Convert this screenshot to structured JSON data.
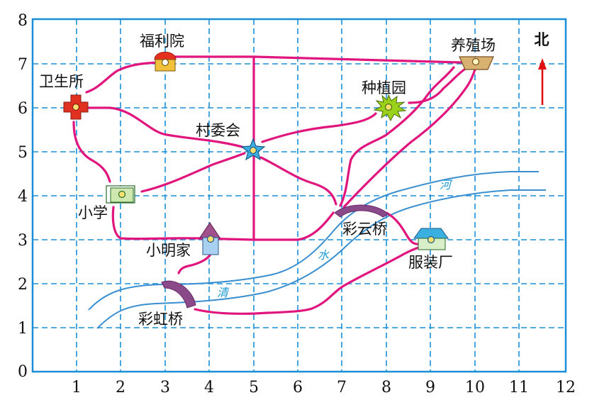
{
  "axes": {
    "x_ticks": [
      "1",
      "2",
      "3",
      "4",
      "5",
      "6",
      "7",
      "8",
      "9",
      "10",
      "11",
      "12"
    ],
    "y_ticks": [
      "0",
      "1",
      "2",
      "3",
      "4",
      "5",
      "6",
      "7",
      "8"
    ]
  },
  "places": {
    "fuliyuan": "福利院",
    "weishengsuo": "卫生所",
    "cunweihui": "村委会",
    "xiaoxue": "小学",
    "xiaomingjia": "小明家",
    "caihongqiao": "彩虹桥",
    "caiyunqiao": "彩云桥",
    "fuzhuangchang": "服装厂",
    "zhongzhiyuan": "种植园",
    "yangzhichang": "养殖场"
  },
  "river": {
    "char1": "清",
    "char2": "水",
    "char3": "河"
  },
  "compass": {
    "north": "北"
  },
  "colors": {
    "grid": "#1a8fd8",
    "road": "#e0157d",
    "river": "#3a8fd0",
    "north_arrow": "#e01010",
    "hospital": "#e03020",
    "star": "#3bb0e0",
    "burst": "#9ad11a",
    "bridge": "#8a4a8a"
  }
}
